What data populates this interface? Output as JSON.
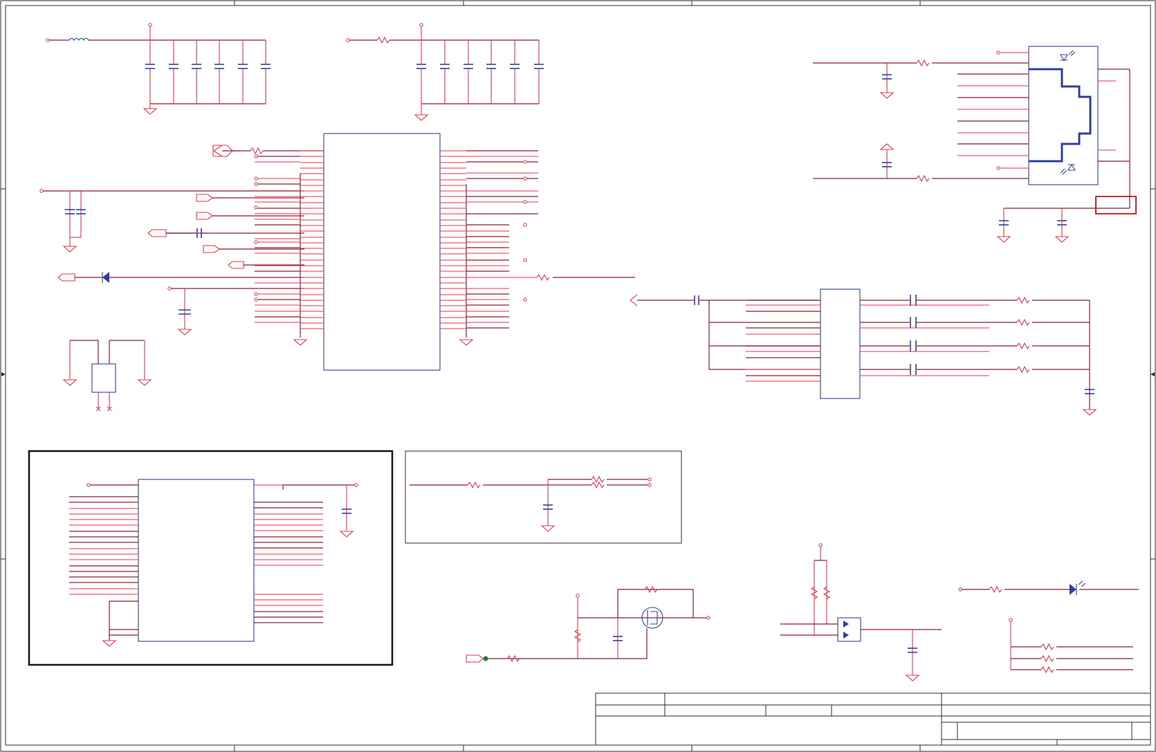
{
  "schematic": {
    "background": "#ffffff",
    "colors": {
      "wire": "#8b1a3a",
      "pin": "#e8334a",
      "component_body": "#2e3f9e",
      "border": "#2a2a2a",
      "highlight_box": "#d42a2a",
      "junction_green": "#1f7a3a"
    },
    "frame": {
      "title_block": {
        "visible": true
      }
    },
    "icons": [
      "ground-symbol",
      "resistor-symbol",
      "capacitor-symbol",
      "inductor-symbol",
      "diode-symbol",
      "led-symbol",
      "mosfet-symbol",
      "rj45-connector-symbol",
      "port-arrow-symbol"
    ]
  }
}
